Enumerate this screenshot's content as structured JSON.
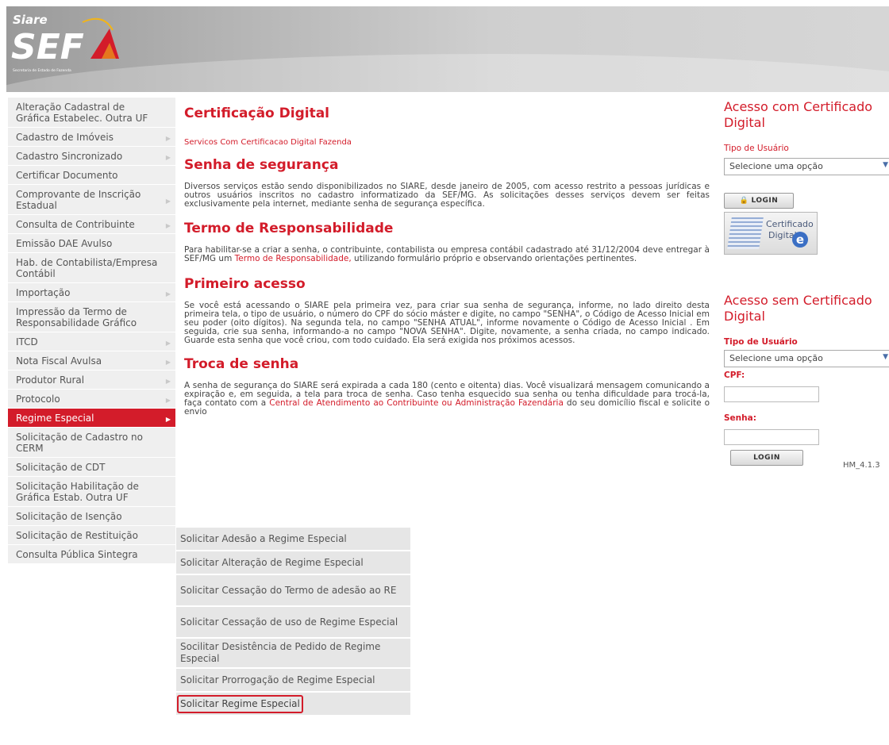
{
  "header": {
    "logo_top": "Siare",
    "logo_main": "SEF",
    "logo_sub": "Secretaria de Estado de Fazenda",
    "brand_red": "#d31c2a"
  },
  "left_menu": {
    "items": [
      {
        "label": "Alteração Cadastral de Gráfica Estabelec. Outra UF",
        "has_arrow": false
      },
      {
        "label": "Cadastro de Imóveis",
        "has_arrow": true
      },
      {
        "label": "Cadastro Sincronizado",
        "has_arrow": true
      },
      {
        "label": "Certificar Documento",
        "has_arrow": false
      },
      {
        "label": "Comprovante de Inscrição Estadual",
        "has_arrow": true
      },
      {
        "label": "Consulta de Contribuinte",
        "has_arrow": true
      },
      {
        "label": "Emissão DAE Avulso",
        "has_arrow": false
      },
      {
        "label": "Hab. de Contabilista/Empresa Contábil",
        "has_arrow": false
      },
      {
        "label": "Importação",
        "has_arrow": true
      },
      {
        "label": "Impressão da Termo de Responsabilidade Gráfico",
        "has_arrow": false
      },
      {
        "label": "ITCD",
        "has_arrow": true
      },
      {
        "label": "Nota Fiscal Avulsa",
        "has_arrow": true
      },
      {
        "label": "Produtor Rural",
        "has_arrow": true
      },
      {
        "label": "Protocolo",
        "has_arrow": true
      },
      {
        "label": "Regime Especial",
        "has_arrow": true,
        "active": true
      },
      {
        "label": "Solicitação de Cadastro no CERM",
        "has_arrow": false
      },
      {
        "label": "Solicitação de CDT",
        "has_arrow": false
      },
      {
        "label": "Solicitação Habilitação de Gráfica Estab. Outra UF",
        "has_arrow": false
      },
      {
        "label": "Solicitação de Isenção",
        "has_arrow": false
      },
      {
        "label": "Solicitação de Restituição",
        "has_arrow": false
      },
      {
        "label": "Consulta Pública Sintegra",
        "has_arrow": false
      }
    ]
  },
  "submenu": {
    "items": [
      {
        "label": "Solicitar Adesão a Regime Especial"
      },
      {
        "label": "Solicitar Alteração de Regime Especial"
      },
      {
        "label": "Solicitar Cessação do Termo de adesão ao RE"
      },
      {
        "label": "Solicitar Cessação de uso de Regime Especial"
      },
      {
        "label": "Socilitar Desistência de Pedido de Regime Especial"
      },
      {
        "label": "Solicitar Prorrogação de Regime Especial"
      },
      {
        "label": "Solicitar Regime Especial",
        "selected": true
      }
    ]
  },
  "content": {
    "title": "Certificação Digital",
    "cert_link": "Servicos Com Certificacao Digital Fazenda",
    "sections": [
      {
        "heading": "Senha de segurança",
        "text": "Diversos serviços estão sendo disponibilizados no SIARE, desde janeiro de 2005, com acesso restrito a pessoas jurídicas e outros usuários inscritos no cadastro informatizado da SEF/MG. As solicitações desses serviços devem ser feitas exclusivamente pela internet, mediante senha de segurança específica."
      },
      {
        "heading": "Termo de Responsabilidade",
        "text_before": "Para habilitar-se a criar a senha, o contribuinte, contabilista ou empresa contábil cadastrado até 31/12/2004 deve entregar à SEF/MG um ",
        "link": "Termo de Responsabilidade,",
        "text_after": " utilizando formulário próprio e observando orientações pertinentes."
      },
      {
        "heading": "Primeiro acesso",
        "text": "Se você está acessando o SIARE pela primeira vez, para criar sua senha de segurança, informe, no lado direito desta primeira tela, o tipo de usuário, o número do CPF do sócio máster e digite, no campo \"SENHA\", o Código de Acesso Inicial em seu poder (oito dígitos). Na segunda tela, no campo \"SENHA ATUAL\", informe novamente o Código de Acesso Inicial . Em seguida, crie sua senha, informando-a no campo \"NOVA SENHA\". Digite, novamente, a senha criada, no campo indicado. Guarde esta senha que você criou, com todo cuidado. Ela será exigida nos próximos acessos."
      },
      {
        "heading": "Troca de senha",
        "text_before": "A senha de segurança do SIARE será expirada a cada 180 (cento e oitenta) dias. Você visualizará mensagem comunicando a expiração e, em seguida, a tela para troca de senha. Caso tenha esquecido sua senha ou tenha dificuldade para trocá-la, faça contato com a ",
        "link": "Central de Atendimento ao Contribuinte ou Administração Fazendária",
        "text_after": " do seu domicílio fiscal e solicite o envio"
      }
    ]
  },
  "right_panel": {
    "with_cert": {
      "heading": "Acesso com Certificado Digital",
      "user_type_label": "Tipo de Usuário",
      "select_value": "Selecione uma opção",
      "login_button": "LOGIN",
      "badge_line1": "Certificado",
      "badge_line2": "Digital",
      "badge_icon": "e"
    },
    "without_cert": {
      "heading": "Acesso sem Certificado Digital",
      "user_type_label": "Tipo de Usuário",
      "select_value": "Selecione uma opção",
      "cpf_label": "CPF:",
      "password_label": "Senha:",
      "login_button": "LOGIN",
      "version": "HM_4.1.3"
    }
  }
}
